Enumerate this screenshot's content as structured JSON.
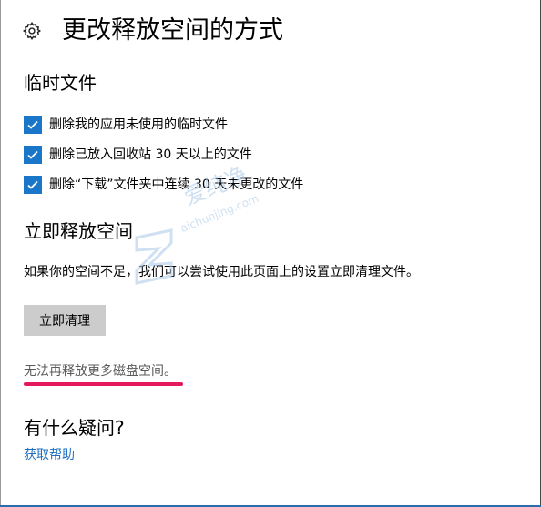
{
  "header": {
    "title": "更改释放空间的方式",
    "icon": "gear-icon"
  },
  "temp_files": {
    "title": "临时文件",
    "options": [
      {
        "label": "删除我的应用未使用的临时文件",
        "checked": true
      },
      {
        "label": "删除已放入回收站 30 天以上的文件",
        "checked": true
      },
      {
        "label": "删除“下载”文件夹中连续 30 天未更改的文件",
        "checked": true
      }
    ]
  },
  "free_now": {
    "title": "立即释放空间",
    "description": "如果你的空间不足，我们可以尝试使用此页面上的设置立即清理文件。",
    "button_label": "立即清理",
    "status": "无法再释放更多磁盘空间。"
  },
  "help": {
    "title": "有什么疑问?",
    "link": "获取帮助"
  },
  "watermark": {
    "text": "爱纯净",
    "sub": "aichunjing.com"
  },
  "colors": {
    "accent": "#1976c9",
    "link": "#1e6fc0",
    "highlight_underline": "#e6195c",
    "button_bg": "#cccccc"
  }
}
